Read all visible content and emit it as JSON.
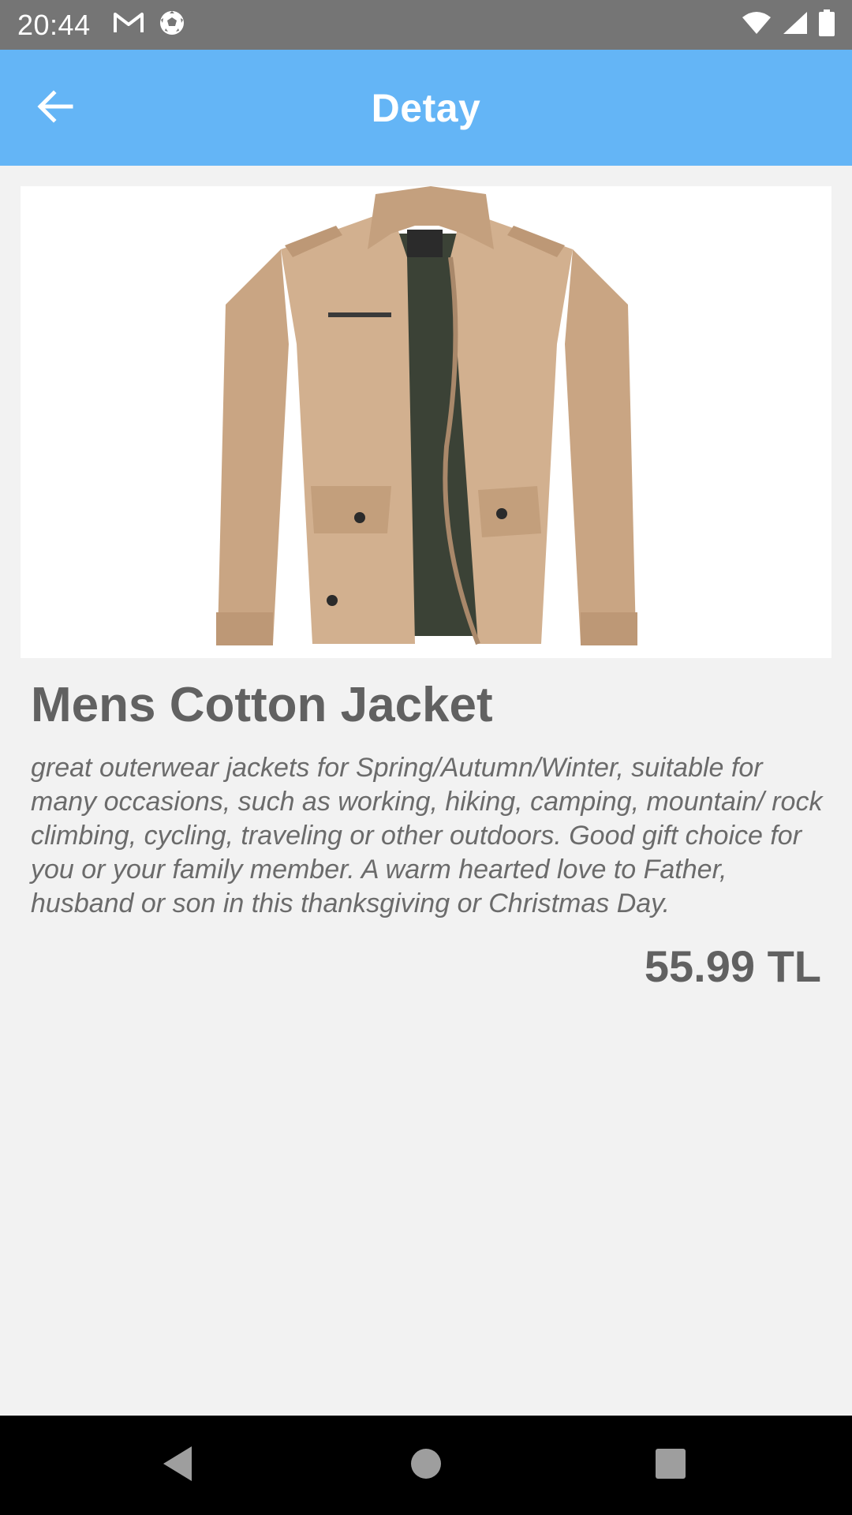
{
  "status_bar": {
    "time": "20:44",
    "left_icons": [
      "gmail-icon",
      "soccer-ball-icon"
    ],
    "right_icons": [
      "wifi-icon",
      "signal-icon",
      "battery-icon"
    ]
  },
  "app_bar": {
    "title": "Detay",
    "back_icon": "arrow-back-icon",
    "background": "#64b5f6"
  },
  "product": {
    "image": "tan-cotton-jacket",
    "title": "Mens Cotton Jacket",
    "description": "great outerwear jackets for Spring/Autumn/Winter, suitable for many occasions, such as working, hiking, camping, mountain/ rock climbing, cycling, traveling or other outdoors. Good gift choice for you or your family member. A warm hearted love to Father, husband or son in this thanksgiving or Christmas Day.",
    "price": "55.99 TL"
  },
  "nav_bar": {
    "buttons": [
      "back-triangle-icon",
      "home-circle-icon",
      "recents-square-icon"
    ]
  }
}
